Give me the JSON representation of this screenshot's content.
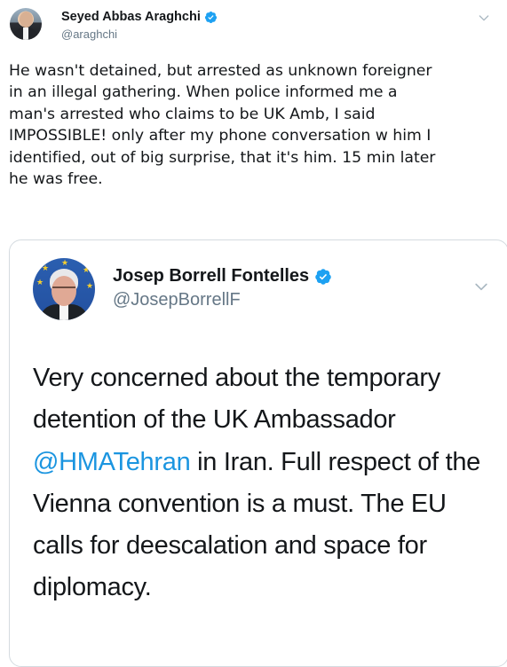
{
  "tweet": {
    "author": {
      "name": "Seyed Abbas Araghchi",
      "handle": "@araghchi"
    },
    "text": "He wasn't detained, but arrested as unknown foreigner\nin an illegal gathering. When police informed me a\nman's arrested who claims to be UK Amb, I said\nIMPOSSIBLE! only after my phone conversation w him I\nidentified, out of big surprise, that it's him. 15 min later\nhe was free."
  },
  "quoted_tweet": {
    "author": {
      "name": "Josep Borrell Fontelles",
      "handle": "@JosepBorrellF"
    },
    "text_before": "Very concerned about the temporary detention of the UK Ambassador ",
    "mention": "@HMATehran",
    "text_after": " in Iran. Full respect of the Vienna convention is a must. The EU calls for deescalation and space for diplomacy."
  },
  "colors": {
    "text": "#14171a",
    "secondary": "#657786",
    "link": "#1b95e0",
    "verified": "#1da1f2",
    "border": "#d4dbe0"
  },
  "icons": {
    "verified": "verified-badge-icon",
    "menu": "chevron-down-icon"
  }
}
